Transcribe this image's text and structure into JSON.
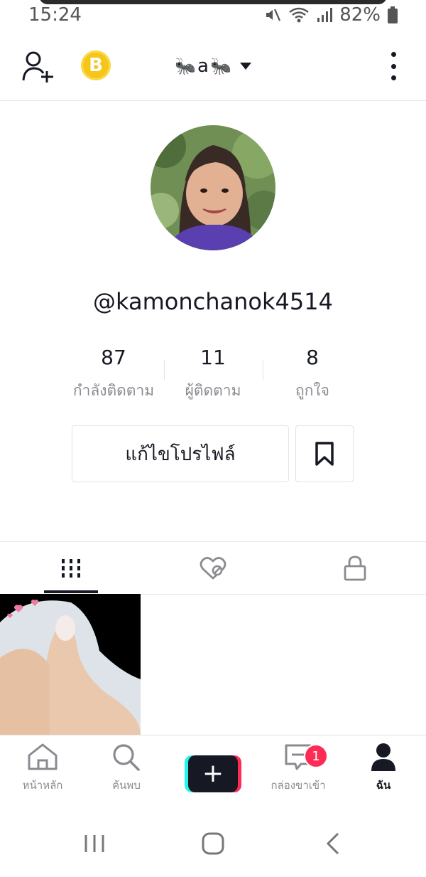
{
  "status_bar": {
    "time": "15:24",
    "battery": "82%"
  },
  "header": {
    "coin_icon_label": "B",
    "display_name_letter": "a",
    "ant_emoji": "🐜"
  },
  "profile": {
    "username": "@kamonchanok4514",
    "stats": [
      {
        "value": "87",
        "label": "กำลังติดตาม"
      },
      {
        "value": "11",
        "label": "ผู้ติดตาม"
      },
      {
        "value": "8",
        "label": "ถูกใจ"
      }
    ],
    "edit_button_label": "แก้ไขโปรไฟล์"
  },
  "tabs": [
    {
      "icon": "grid-icon",
      "active": true
    },
    {
      "icon": "liked-hidden-icon",
      "active": false
    },
    {
      "icon": "lock-icon",
      "active": false
    }
  ],
  "bottom_nav": {
    "items": [
      {
        "label": "หน้าหลัก",
        "icon": "home-icon"
      },
      {
        "label": "ค้นพบ",
        "icon": "search-icon"
      },
      {
        "label": "",
        "icon": "create-plus-icon"
      },
      {
        "label": "กล่องขาเข้า",
        "icon": "inbox-icon"
      },
      {
        "label": "ฉัน",
        "icon": "profile-icon"
      }
    ],
    "inbox_badge": "1"
  },
  "colors": {
    "accent_red": "#fe2c55",
    "accent_cyan": "#25f4ee",
    "text_primary": "#161823",
    "text_secondary": "#8a8b91",
    "coin": "#f5c518"
  }
}
